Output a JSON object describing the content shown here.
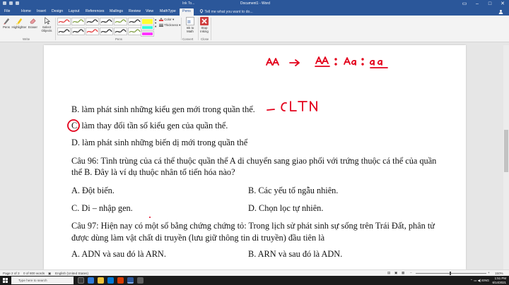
{
  "window": {
    "doc_title": "Document1 - Word",
    "context_label": "Ink To..."
  },
  "tabs": [
    "File",
    "Home",
    "Insert",
    "Design",
    "Layout",
    "References",
    "Mailings",
    "Review",
    "View",
    "MathType",
    "Pens"
  ],
  "active_tab": "Pens",
  "tell_me_placeholder": "Tell me what you want to do...",
  "ribbon": {
    "write_tools": [
      "Pens",
      "Highlighter",
      "Eraser",
      "Select Objects"
    ],
    "write_group": "Write",
    "pens_group": "Pens",
    "color_label": "Color",
    "thickness_label": "Thickness",
    "ink_to_math": "Ink to Math",
    "convert_group": "Convert",
    "stop_inking": "Stop Inking",
    "close_group": "Close",
    "pen_colors": [
      "#e03030",
      "#7a9a3a",
      "#2a2a2a",
      "#2a2a2a",
      "#7a9a3a",
      "#2a2a2a",
      "#ffff33",
      "#ffff33",
      "#2a2a2a",
      "#2a2a2a",
      "#e03030",
      "#2a2a2a",
      "#33ffdd",
      "#ff33ff"
    ]
  },
  "document": {
    "lines": [
      "B. làm phát sinh những kiểu gen mới trong quần thể.",
      "C. làm thay đổi tần số kiểu gen của quần thể.",
      "D. làm phát sinh những biến dị mới trong quần thể",
      "Câu 96: Tình trùng của cá thể thuộc quần thể A di chuyển sang giao phối với trứng thuộc cá thể của quần",
      "thể B. Đây là ví dụ thuộc nhân tố tiến hóa nào?",
      "A. Đột biến.",
      "B. Các yếu tố ngẫu nhiên.",
      "C. Di – nhập gen.",
      "D. Chọn lọc tự nhiên.",
      "Câu 97: Hiện nay có một số bằng chứng chứng tỏ: Trong lịch sử phát sinh sự sống trên Trái Đất, phân tử",
      "được dùng làm vật chất di truyền (lưu giữ thông tin di truyền) đầu tiên là",
      "A. ADN và sau đó là ARN.",
      "B. ARN và sau đó là ADN."
    ],
    "ink_notes": {
      "cltn": "CLTN",
      "genotypes": "AA → AA : Aa : aa"
    },
    "ink_color": "#e3001b"
  },
  "status": {
    "page": "Page 2 of 3",
    "words": "0 of 800 words",
    "language": "English (United States)",
    "zoom": "150%"
  },
  "taskbar": {
    "search_placeholder": "Type here to search",
    "language": "ENG",
    "time": "1:51 PM",
    "date": "6/14/2021"
  }
}
